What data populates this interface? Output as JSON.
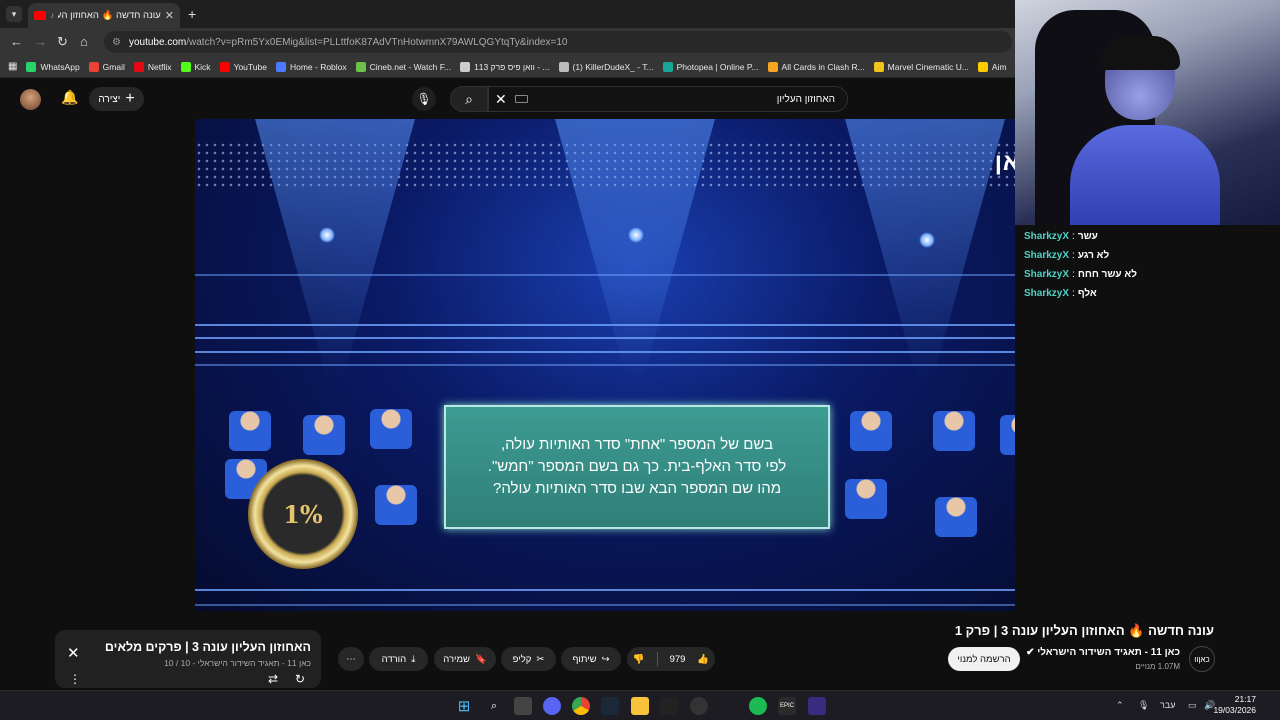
{
  "browser": {
    "tab_title": "עונה חדשה 🔥 האחוזון העליון",
    "url_host": "youtube.com",
    "url_path": "/watch?v=pRm5Yx0EMig&list=PLLttfoK87AdVTnHotwmnX79AWLQGYtqTy&index=10",
    "bookmarks": [
      {
        "label": "WhatsApp",
        "color": "#25d366"
      },
      {
        "label": "Gmail",
        "color": "#ea4335"
      },
      {
        "label": "Netflix",
        "color": "#e50914"
      },
      {
        "label": "Kick",
        "color": "#53fc18"
      },
      {
        "label": "YouTube",
        "color": "#ff0000"
      },
      {
        "label": "Home - Roblox",
        "color": "#4a7bff"
      },
      {
        "label": "Cineb.net - Watch F...",
        "color": "#6cc24a"
      },
      {
        "label": "וואן פיס פרק 113 - ...",
        "color": "#cccccc"
      },
      {
        "label": "(1) KillerDudeX_ - T...",
        "color": "#bbbbbb"
      },
      {
        "label": "Photopea | Online P...",
        "color": "#18a497"
      },
      {
        "label": "All Cards in Clash R...",
        "color": "#f5a623"
      },
      {
        "label": "Marvel Cinematic U...",
        "color": "#f0c419"
      },
      {
        "label": "Aim",
        "color": "#ffcc00"
      }
    ]
  },
  "youtube": {
    "create_label": "יצירה",
    "search_query": "האחוזון העליון",
    "video_title": "עונה חדשה 🔥 האחוזון העליון עונה 3 | פרק 1",
    "channel_name": "כאן 11 - תאגיד השידור הישראלי",
    "channel_avatar_text": "כאןוו",
    "subscribers": "1.07M מנויים",
    "subscribe_label": "הרשמה למנוי",
    "like_count": "979",
    "share_label": "שיתוף",
    "clip_label": "קליפ",
    "save_label": "שמירה",
    "download_label": "הורדה",
    "miniplayer": {
      "title": "האחוזון העליון עונה 3 | פרקים מלאים",
      "subtitle": "כאן 11 - תאגיד השידור הישראלי - 10 / 10"
    }
  },
  "video": {
    "channel_logo": "11|כאן",
    "coin_text": "1%",
    "question_lines": [
      "בשם של המספר \"אחת\" סדר האותיות עולה,",
      "לפי סדר האלף-בית. כך גם בשם המספר \"חמש\".",
      "מהו שם המספר הבא שבו סדר האותיות עולה?"
    ]
  },
  "chat": [
    {
      "user": "SharkzyX",
      "message": "עשר"
    },
    {
      "user": "SharkzyX",
      "message": "לא רגע"
    },
    {
      "user": "SharkzyX",
      "message": "לא עשר חחח"
    },
    {
      "user": "SharkzyX",
      "message": "אלף"
    }
  ],
  "taskbar": {
    "language": "עבר",
    "time": "21:17",
    "date": "19/03/2026"
  },
  "colors": {
    "accent_chat_user": "#4fd1c5",
    "question_box": "#3d9c93",
    "youtube_red": "#ff0000"
  }
}
